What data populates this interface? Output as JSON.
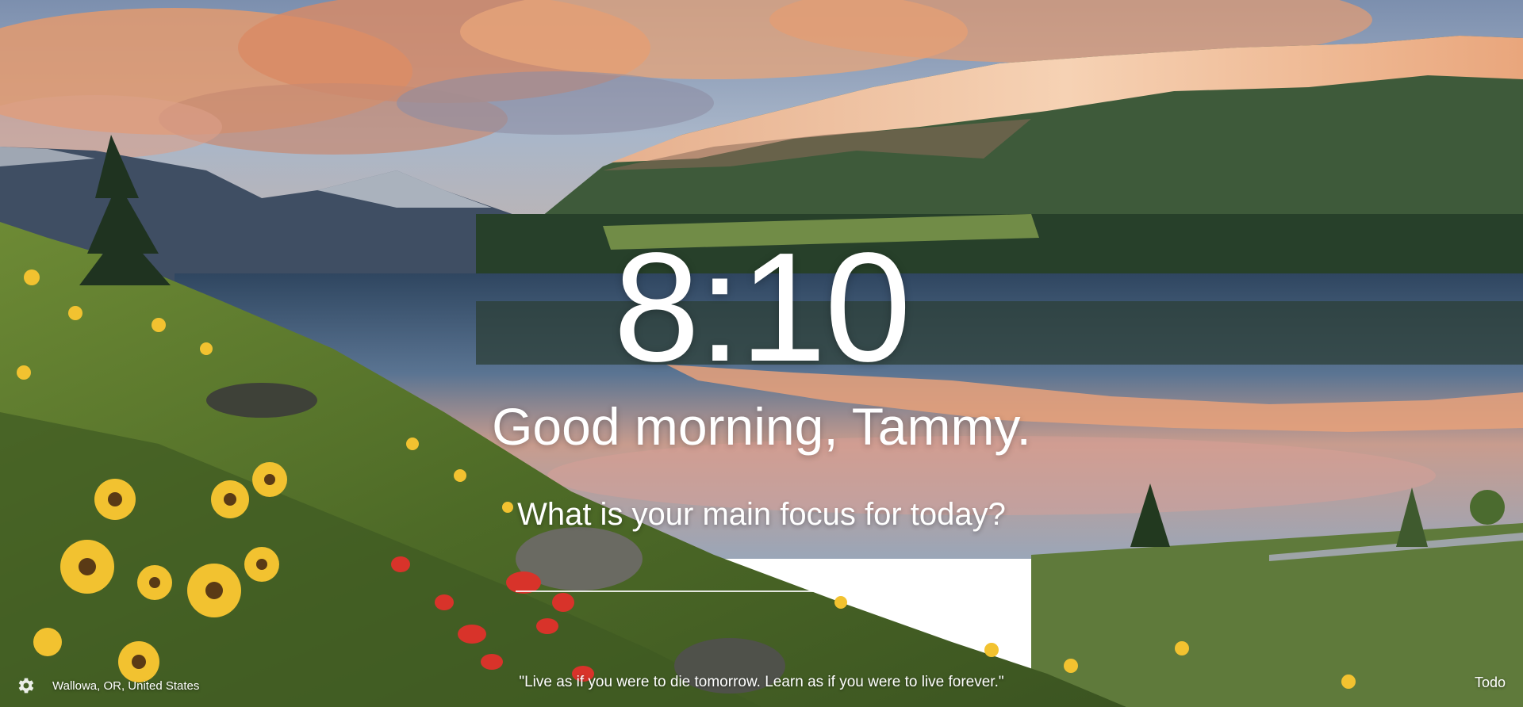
{
  "background": {
    "description_icon": "mountain-lake-landscape",
    "colors": {
      "sky_top": "#6f8aa8",
      "cloud_orange": "#e89a6a",
      "peak_glow": "#f0b48a",
      "forest": "#2f4a2e",
      "lake": "#3d5a78",
      "meadow": "#5d7a2c",
      "flower_yellow": "#f2c230",
      "flower_red": "#d8332a"
    }
  },
  "clock": {
    "time": "8:10"
  },
  "greeting": {
    "text": "Good morning, Tammy."
  },
  "focus": {
    "prompt": "What is your main focus for today?",
    "value": ""
  },
  "footer": {
    "settings_icon": "gear-icon",
    "location": "Wallowa, OR, United States",
    "quote": "\"Live as if you were to die tomorrow. Learn as if you were to live forever.\"",
    "todo_label": "Todo"
  }
}
